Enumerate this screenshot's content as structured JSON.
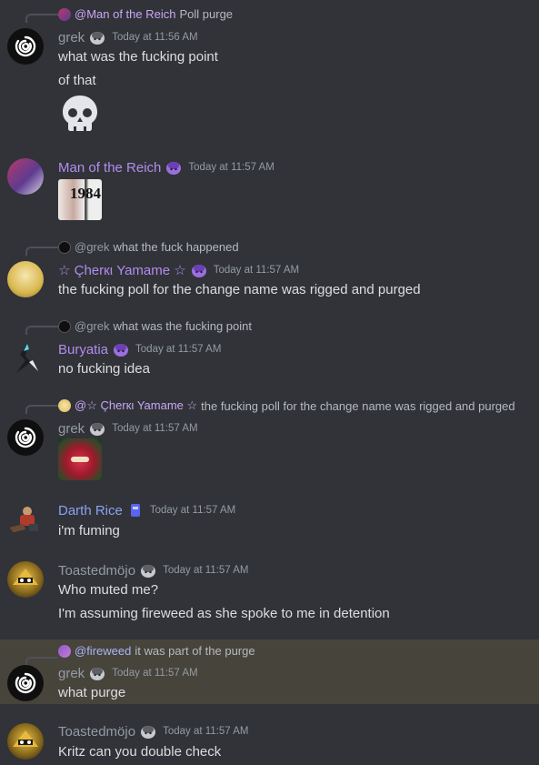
{
  "messages": [
    {
      "reply": {
        "mention": "@Man of the Reich",
        "text": "Poll purge"
      },
      "author": "grek",
      "time": "Today at 11:56 AM",
      "lines": [
        "what was the fucking point",
        "of that"
      ],
      "emoji": "skull"
    },
    {
      "author": "Man of the Reich",
      "time": "Today at 11:57 AM",
      "image_caption": "1984"
    },
    {
      "reply": {
        "mention": "@grek",
        "text": "what the fuck happened"
      },
      "author": "☆ Çherкι Yamame ☆",
      "time": "Today at 11:57 AM",
      "lines": [
        "the fucking poll for the change name was rigged and purged"
      ]
    },
    {
      "reply": {
        "mention": "@grek",
        "text": "what was the fucking point"
      },
      "author": "Buryatia",
      "time": "Today at 11:57 AM",
      "lines": [
        "no fucking idea"
      ]
    },
    {
      "reply": {
        "mention": "@☆ Çherкι Yamame ☆",
        "text": "the fucking poll for the change name was rigged and purged"
      },
      "author": "grek",
      "time": "Today at 11:57 AM"
    },
    {
      "author": "Darth Rice",
      "time": "Today at 11:57 AM",
      "lines": [
        "i'm fuming"
      ]
    },
    {
      "author": "Toastedmöjo",
      "time": "Today at 11:57 AM",
      "lines": [
        "Who muted me?",
        "I'm assuming fireweed as she spoke to me in detention"
      ]
    },
    {
      "reply": {
        "mention": "@fireweed",
        "text": "it was part of the purge"
      },
      "author": "grek",
      "time": "Today at 11:57 AM",
      "lines": [
        "what purge"
      ]
    },
    {
      "author": "Toastedmöjo",
      "time": "Today at 11:57 AM",
      "lines": [
        "Kritz can you double check"
      ]
    }
  ],
  "colors": {
    "background": "#313338",
    "highlight": "#47443b",
    "mention": "#c9a6f7",
    "name_purple": "#b28cf0",
    "name_blue": "#8ba1f2",
    "name_grey": "#949ba4"
  }
}
